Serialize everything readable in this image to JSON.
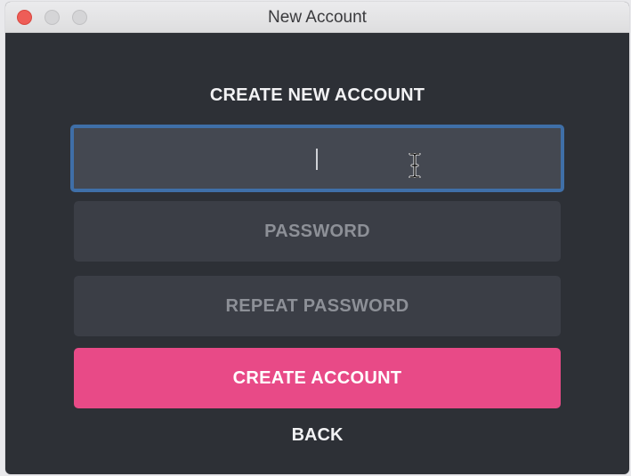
{
  "window": {
    "title": "New Account"
  },
  "form": {
    "heading": "CREATE NEW ACCOUNT",
    "username": {
      "value": "",
      "placeholder": ""
    },
    "password": {
      "placeholder": "PASSWORD"
    },
    "repeat_password": {
      "placeholder": "REPEAT PASSWORD"
    },
    "create_button_label": "CREATE ACCOUNT",
    "back_link_label": "BACK"
  },
  "icons": {
    "close": "close-icon",
    "minimize": "minimize-icon",
    "maximize": "maximize-icon",
    "cursor": "text-cursor-icon"
  },
  "colors": {
    "background": "#2d3036",
    "field": "#3b3e46",
    "focus_border": "#3f6fa8",
    "accent": "#e84a87",
    "text": "#f2f2f4",
    "placeholder": "#8d9097"
  }
}
